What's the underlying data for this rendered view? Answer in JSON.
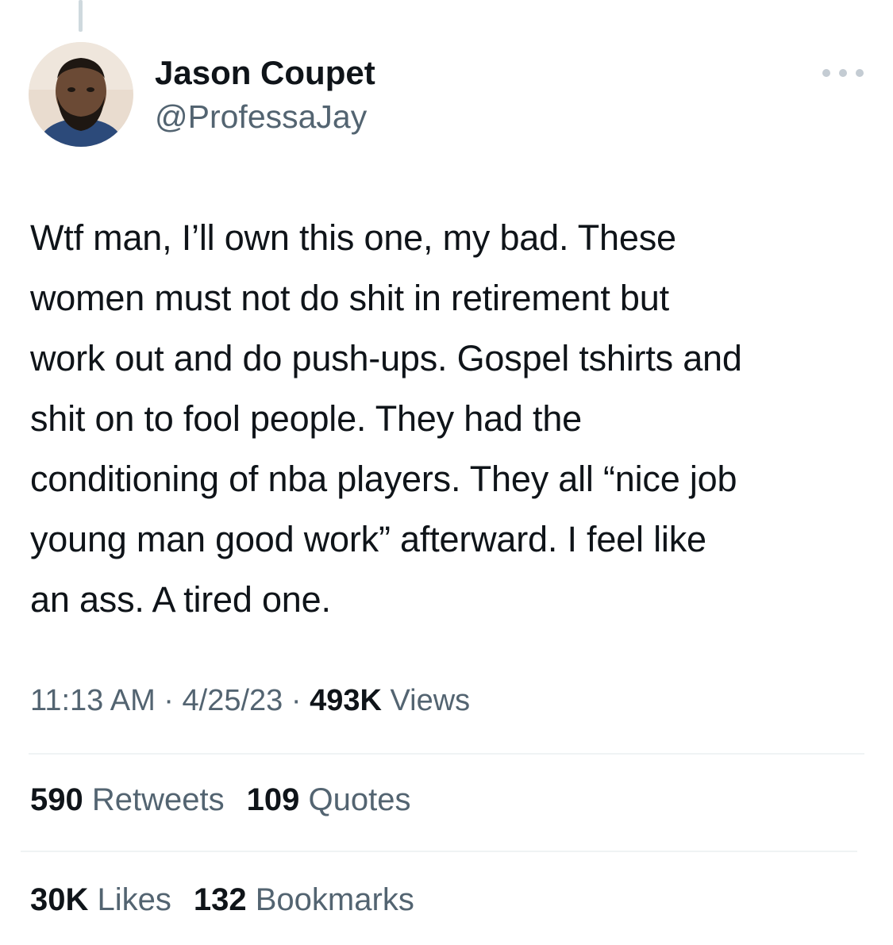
{
  "author": {
    "name": "Jason Coupet",
    "handle": "@ProfessaJay"
  },
  "tweet": {
    "lines": [
      "Wtf man, I’ll own this one, my bad. These",
      "women must not do shit in retirement but",
      "work out and do push-ups. Gospel tshirts and",
      "shit on to fool people. They had the",
      "conditioning of nba players. They all “nice job",
      "young man good work” afterward. I feel like",
      "an ass. A tired one."
    ]
  },
  "meta": {
    "time": "11:13 AM",
    "sep1": " · ",
    "date": "4/25/23",
    "sep2": " · ",
    "views_count": "493K",
    "views_label": " Views"
  },
  "stats": {
    "retweets_count": "590",
    "retweets_label": " Retweets",
    "quotes_count": "109",
    "quotes_label": " Quotes",
    "likes_count": "30K",
    "likes_label": " Likes",
    "bookmarks_count": "132",
    "bookmarks_label": " Bookmarks"
  },
  "icons": {
    "more": "more-dots-icon"
  },
  "colors": {
    "text_primary": "#0f1419",
    "text_secondary": "#536471",
    "divider": "#eff3f4",
    "thread_line": "#cfd9de"
  }
}
